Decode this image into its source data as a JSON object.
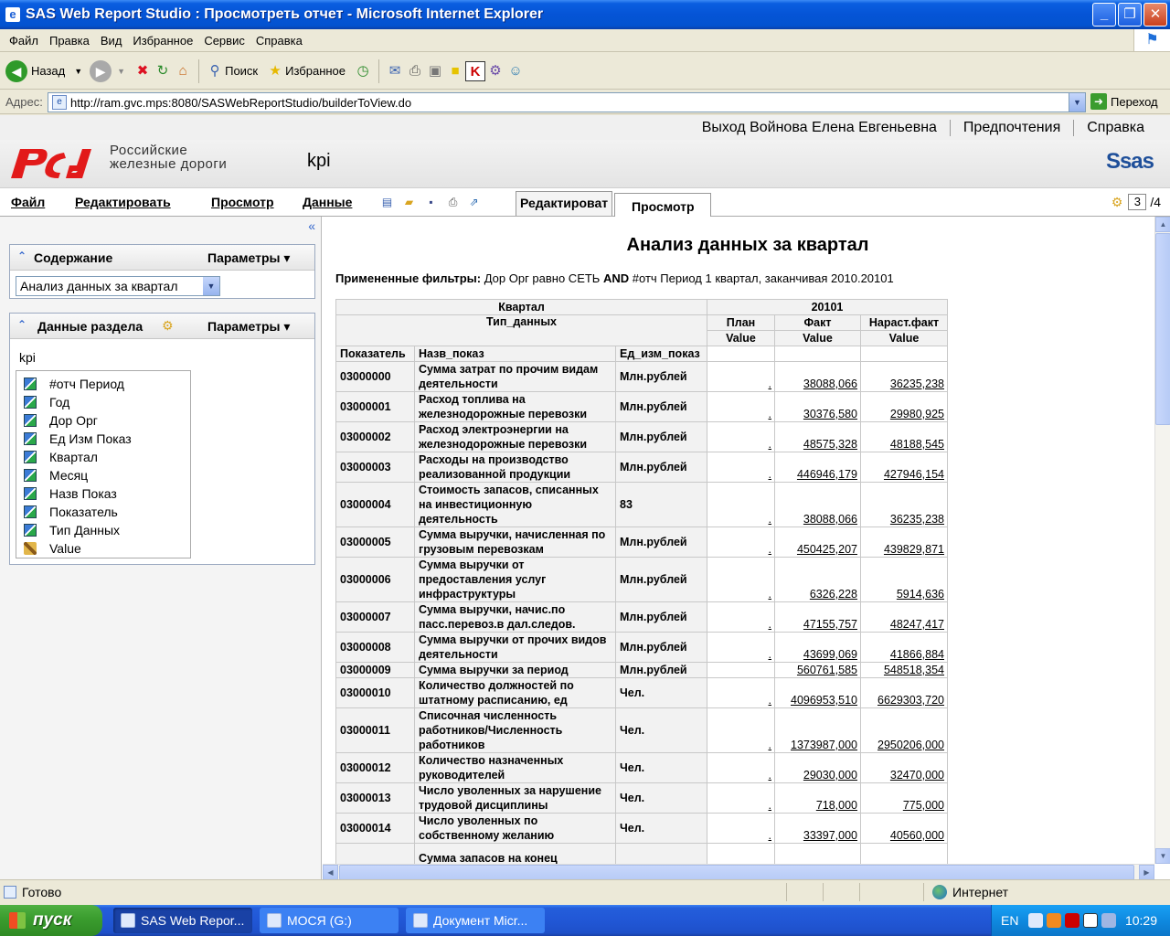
{
  "window": {
    "title": "SAS Web Report Studio : Просмотреть отчет - Microsoft Internet Explorer",
    "minimize": "_",
    "maximize": "❐",
    "close": "✕"
  },
  "ie_menu": [
    "Файл",
    "Правка",
    "Вид",
    "Избранное",
    "Сервис",
    "Справка"
  ],
  "ie_toolbar": {
    "back": "Назад",
    "search": "Поиск",
    "favorites": "Избранное"
  },
  "address": {
    "label": "Адрес:",
    "url": "http://ram.gvc.mps:8080/SASWebReportStudio/builderToView.do",
    "go": "Переход"
  },
  "sas_header": {
    "logout": "Выход Войнова Елена Евгеньевна",
    "preferences": "Предпочтения",
    "help": "Справка"
  },
  "banner": {
    "org_line1": "Российские",
    "org_line2": "железные дороги",
    "report_name": "kpi",
    "sas_logo": "Ssas"
  },
  "app_menu": {
    "file": "Файл",
    "edit": "Редактировать",
    "view": "Просмотр",
    "data": "Данные",
    "tab_edit": "Редактироват",
    "tab_view": "Просмотр",
    "page_current": "3",
    "page_total": "/4"
  },
  "left_panel": {
    "collapse": "«",
    "contents_title": "Содержание",
    "contents_params": "Параметры ▾",
    "contents_selected": "Анализ данных за квартал",
    "section_data_title": "Данные раздела",
    "section_params": "Параметры ▾",
    "data_source": "kpi",
    "fields": [
      {
        "label": "#отч Период",
        "icon": "category-icon"
      },
      {
        "label": "Год",
        "icon": "category-icon"
      },
      {
        "label": "Дор Орг",
        "icon": "category-icon"
      },
      {
        "label": "Ед Изм Показ",
        "icon": "category-icon"
      },
      {
        "label": "Квартал",
        "icon": "category-icon"
      },
      {
        "label": "Месяц",
        "icon": "category-icon"
      },
      {
        "label": "Назв Показ",
        "icon": "category-icon"
      },
      {
        "label": "Показатель",
        "icon": "category-icon"
      },
      {
        "label": "Тип Данных",
        "icon": "category-icon"
      },
      {
        "label": "Value",
        "icon": "measure-icon"
      }
    ]
  },
  "report": {
    "title": "Анализ данных за квартал",
    "filters_label": "Примененные фильтры:",
    "filters_part1": "Дор Орг равно СЕТЬ",
    "filters_and": "AND",
    "filters_part2": "#отч Период 1 квартал, заканчивая 2010.20101",
    "table": {
      "hdr_quarter": "Квартал",
      "hdr_datatype": "Тип_данных",
      "hdr_period": "20101",
      "hdr_plan": "План",
      "hdr_fact": "Факт",
      "hdr_cumfact": "Нараст.факт",
      "hdr_value": "Value",
      "col_code": "Показатель",
      "col_name": "Назв_показ",
      "col_unit": "Ед_изм_показ",
      "rows": [
        {
          "code": "03000000",
          "name": "Сумма затрат по прочим видам деятельности",
          "unit": "Млн.рублей",
          "plan": ".",
          "fact": "38088,066",
          "cum": "36235,238",
          "h": 33
        },
        {
          "code": "03000001",
          "name": "Расход топлива на железнодорожные перевозки",
          "unit": "Млн.рублей",
          "plan": ".",
          "fact": "30376,580",
          "cum": "29980,925",
          "h": 33
        },
        {
          "code": "03000002",
          "name": "Расход электроэнергии на железнодорожные перевозки",
          "unit": "Млн.рублей",
          "plan": ".",
          "fact": "48575,328",
          "cum": "48188,545",
          "h": 33
        },
        {
          "code": "03000003",
          "name": "Расходы на производство реализованной продукции",
          "unit": "Млн.рублей",
          "plan": ".",
          "fact": "446946,179",
          "cum": "427946,154",
          "h": 33
        },
        {
          "code": "03000004",
          "name": "Стоимость запасов, списанных на инвестиционную деятельность",
          "unit": "83",
          "plan": ".",
          "fact": "38088,066",
          "cum": "36235,238",
          "h": 49
        },
        {
          "code": "03000005",
          "name": "Сумма выручки, начисленная по грузовым перевозкам",
          "unit": "Млн.рублей",
          "plan": ".",
          "fact": "450425,207",
          "cum": "439829,871",
          "h": 33
        },
        {
          "code": "03000006",
          "name": "Сумма выручки от предоставления услуг инфраструктуры",
          "unit": "Млн.рублей",
          "plan": ".",
          "fact": "6326,228",
          "cum": "5914,636",
          "h": 49
        },
        {
          "code": "03000007",
          "name": "Сумма выручки, начис.по пасс.перевоз.в дал.следов.",
          "unit": "Млн.рублей",
          "plan": ".",
          "fact": "47155,757",
          "cum": "48247,417",
          "h": 33
        },
        {
          "code": "03000008",
          "name": "Сумма выручки от прочих видов деятельности",
          "unit": "Млн.рублей",
          "plan": ".",
          "fact": "43699,069",
          "cum": "41866,884",
          "h": 33
        },
        {
          "code": "03000009",
          "name": "Сумма выручки за период",
          "unit": "Млн.рублей",
          "plan": "",
          "fact": "560761,585",
          "cum": "548518,354",
          "h": 17
        },
        {
          "code": "03000010",
          "name": "Количество должностей по штатному расписанию, ед",
          "unit": "Чел.",
          "plan": ".",
          "fact": "4096953,510",
          "cum": "6629303,720",
          "h": 33
        },
        {
          "code": "03000011",
          "name": "Списочная численность работников/Численность работников",
          "unit": "Чел.",
          "plan": ".",
          "fact": "1373987,000",
          "cum": "2950206,000",
          "h": 49
        },
        {
          "code": "03000012",
          "name": "Количество назначенных руководителей",
          "unit": "Чел.",
          "plan": ".",
          "fact": "29030,000",
          "cum": "32470,000",
          "h": 33
        },
        {
          "code": "03000013",
          "name": "Число уволенных за нарушение трудовой дисциплины",
          "unit": "Чел.",
          "plan": ".",
          "fact": "718,000",
          "cum": "775,000",
          "h": 33
        },
        {
          "code": "03000014",
          "name": "Число уволенных по собственному желанию",
          "unit": "Чел.",
          "plan": ".",
          "fact": "33397,000",
          "cum": "40560,000",
          "h": 33
        },
        {
          "code": "",
          "name": "Сумма запасов на конец",
          "unit": "",
          "plan": "",
          "fact": "",
          "cum": "",
          "h": 33
        }
      ]
    }
  },
  "status": {
    "text": "Готово",
    "zone": "Интернет"
  },
  "taskbar": {
    "start": "пуск",
    "items": [
      "SAS Web Repor...",
      "МОСЯ (G:)",
      "Документ Micr..."
    ],
    "lang": "EN",
    "clock": "10:29"
  },
  "colors": {
    "xp_blue": "#0554d6",
    "rzd_red": "#e21a1a",
    "sas_blue": "#1e4f9a"
  }
}
